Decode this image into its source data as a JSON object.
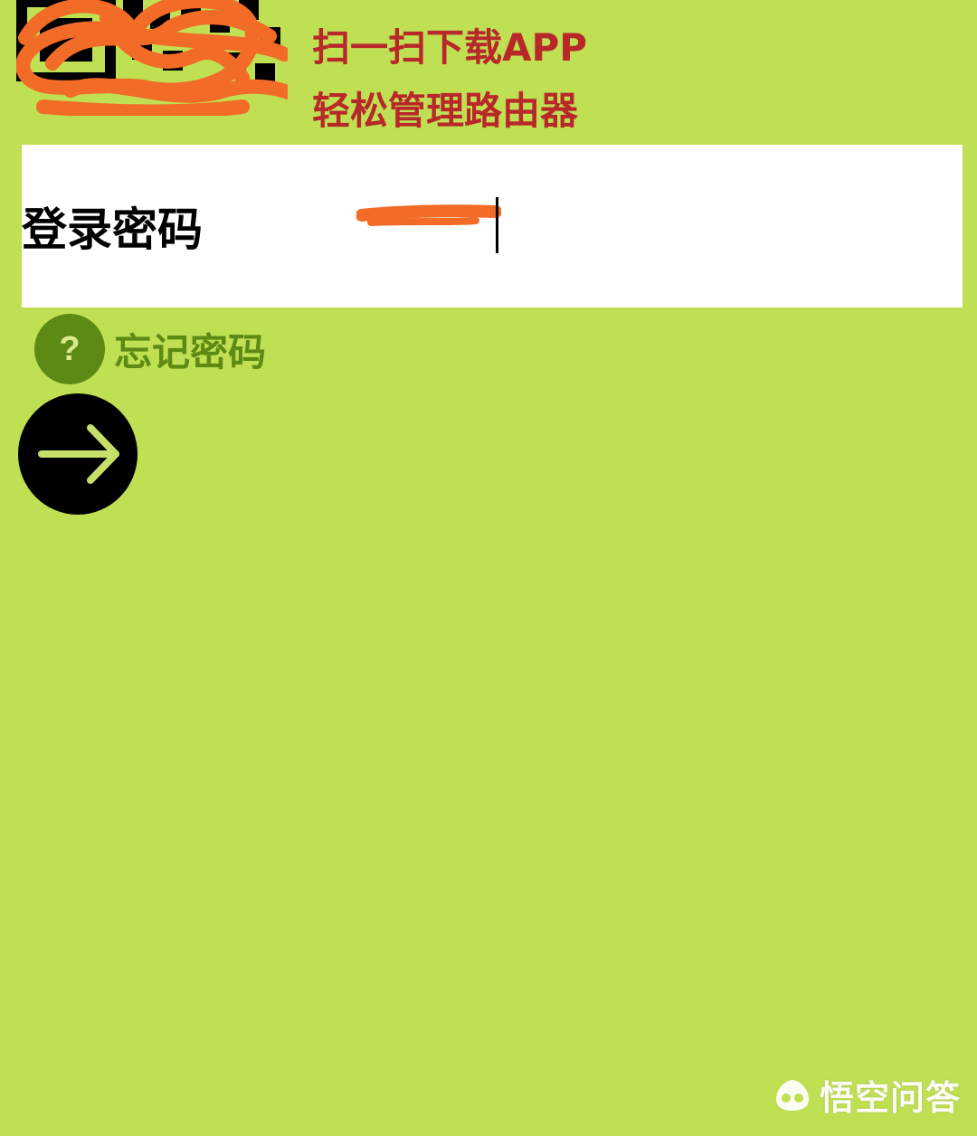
{
  "qr": {
    "icon": "qr-code-icon"
  },
  "promo": {
    "line1": "扫一扫下载APP",
    "line2": "轻松管理路由器"
  },
  "login": {
    "label": "登录密码",
    "password_value": ""
  },
  "forgot": {
    "label": "忘记密码",
    "icon": "question-icon"
  },
  "next": {
    "icon": "arrow-right-icon"
  },
  "watermark": {
    "text": "悟空问答",
    "icon": "wukong-logo"
  },
  "colors": {
    "background": "#bfe053",
    "promo_text": "#b8282a",
    "forgot_text": "#5e8a14",
    "scribble": "#f26b27"
  }
}
